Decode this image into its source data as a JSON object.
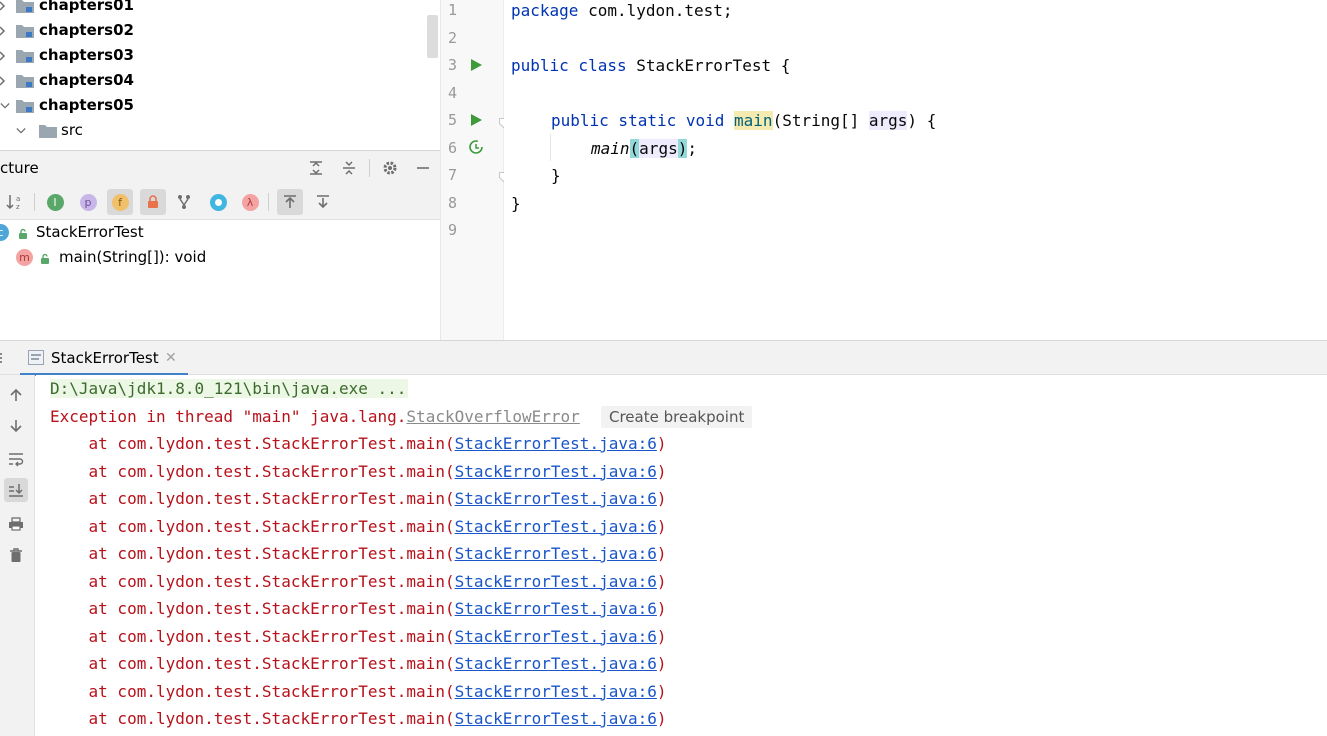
{
  "project_tree": {
    "items": [
      {
        "label": "chapters01"
      },
      {
        "label": "chapters02"
      },
      {
        "label": "chapters03"
      },
      {
        "label": "chapters04"
      },
      {
        "label": "chapters05"
      },
      {
        "label": "src"
      }
    ]
  },
  "structure": {
    "title": "cture",
    "class_name": "StackErrorTest",
    "method_name": "main(String[]): void",
    "toolbar_icons": [
      "sort-alpha-icon",
      "inherited-icon",
      "properties-icon",
      "fields-icon",
      "non-public-icon",
      "branch-icon",
      "anonymous-icon",
      "lambda-icon",
      "autoscroll-to-source-icon",
      "autoscroll-from-source-icon"
    ]
  },
  "editor": {
    "line_numbers": [
      "1",
      "2",
      "3",
      "4",
      "5",
      "6",
      "7",
      "8",
      "9"
    ],
    "lines": {
      "l1_kw": "package",
      "l1_rest": " com.lydon.test;",
      "l3_kw": "public class",
      "l3_rest": " StackErrorTest {",
      "l5_kw1": "public static void",
      "l5_method": "main",
      "l5_paren": "(String[] ",
      "l5_param": "args",
      "l5_end": ") {",
      "l6_call": "main",
      "l6_open": "(",
      "l6_arg": "args",
      "l6_close": ")",
      "l6_semi": ";",
      "l7": "}",
      "l8": "}"
    }
  },
  "run_panel": {
    "tab_label": "StackErrorTest",
    "command": "D:\\Java\\jdk1.8.0_121\\bin\\java.exe ...",
    "exception_prefix": "Exception in thread \"main\" java.lang.",
    "exception_class": "StackOverflowError",
    "tooltip": "Create breakpoint",
    "stack_prefix": "    at com.lydon.test.StackErrorTest.main(",
    "stack_link": "StackErrorTest.java:6",
    "stack_suffix": ")",
    "stack_count": 11
  },
  "colors": {
    "keyword": "#0033b3",
    "error_text": "#b7121b",
    "link": "#1a56c9",
    "run_green": "#3d9b3a"
  }
}
